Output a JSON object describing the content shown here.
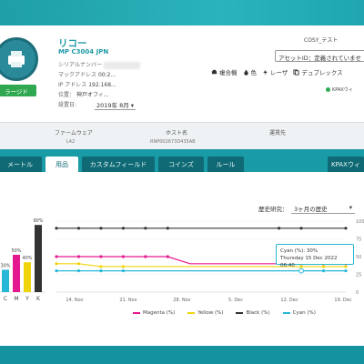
{
  "device": {
    "brand": "リコー",
    "model": "MP C3004 JPN",
    "badge": "ラージド",
    "fields": [
      {
        "label": "シリアルナンバー",
        "value": ""
      },
      {
        "label": "マックアドレス",
        "value": "00:2..."
      },
      {
        "label": "IP アドレス",
        "value": "192.168..."
      },
      {
        "label": "位置：",
        "value": "神戸オフィ..."
      }
    ],
    "install_label": "設置日:",
    "install_value": "2019年 8月 ▾"
  },
  "top_right": {
    "name": "COSY_テスト",
    "asset": "アセットID：定義されていませ",
    "actions": [
      "複合機",
      "色",
      "レーザ",
      "デュプレックス"
    ],
    "kpax": "KPAXウィ"
  },
  "strip": [
    {
      "label": "ファームウェア",
      "value": "L42"
    },
    {
      "label": "ホスト名",
      "value": "RNP002673D435AB"
    },
    {
      "label": "運賃先",
      "value": ""
    }
  ],
  "tabs": [
    "メートル",
    "用品",
    "カスタムフィールド",
    "コインズ",
    "ルール",
    "KPAXウィ"
  ],
  "active_tab": 1,
  "history": {
    "label": "歴史研究：",
    "value": "3ヶ月の歴史"
  },
  "colors": {
    "magenta": "#e5198f",
    "yellow": "#f0d40a",
    "black": "#333333",
    "cyan": "#27b7d7",
    "accent": "#1e9aa6"
  },
  "chart_data": [
    {
      "type": "bar",
      "categories": [
        "C",
        "M",
        "Y",
        "K"
      ],
      "values": [
        30,
        50,
        40,
        90
      ],
      "data_labels": [
        "30%",
        "50%",
        "40%",
        "90%"
      ]
    },
    {
      "type": "line",
      "x_ticks": [
        "14. Nov",
        "21. Nov",
        "28. Nov",
        "5. Dec",
        "12. Dec",
        "19. Dec"
      ],
      "y_ticks": [
        "100",
        "75",
        "50",
        "25",
        "0"
      ],
      "ylim": [
        0,
        100
      ],
      "series": [
        {
          "name": "Black (%)",
          "values": [
            90,
            90,
            90,
            90,
            90,
            90,
            90,
            90,
            90,
            90,
            90,
            90,
            90,
            90
          ]
        },
        {
          "name": "Magenta (%)",
          "values": [
            50,
            50,
            50,
            50,
            50,
            50,
            40,
            40,
            40,
            40,
            40,
            40,
            40,
            40
          ]
        },
        {
          "name": "Yellow (%)",
          "values": [
            40,
            40,
            36,
            36,
            36,
            36,
            36,
            36,
            36,
            36,
            36,
            36,
            36,
            36
          ]
        },
        {
          "name": "Cyan (%)",
          "values": [
            30,
            30,
            30,
            30,
            30,
            30,
            30,
            30,
            30,
            30,
            30,
            30,
            30,
            30
          ]
        }
      ],
      "legend": [
        "Magenta (%)",
        "Yellow (%)",
        "Black (%)",
        "Cyan (%)"
      ],
      "tooltip": {
        "line1": "Cyan (%): 30%",
        "line2": "Thursday 15 Dec 2022 06:40"
      }
    }
  ]
}
